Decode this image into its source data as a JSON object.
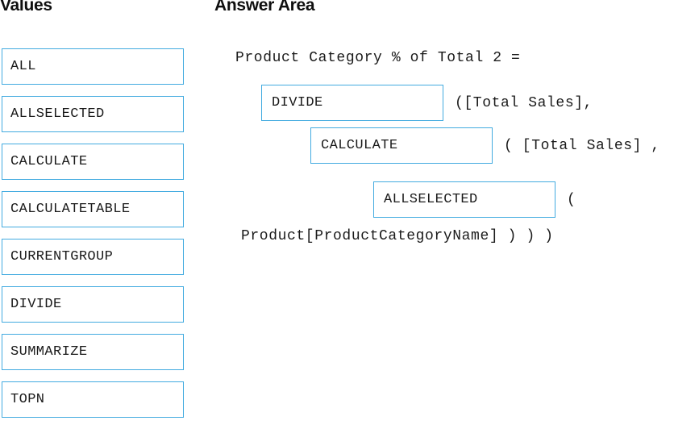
{
  "headings": {
    "values": "Values",
    "answer_area": "Answer Area"
  },
  "values_list": {
    "items": [
      {
        "label": "ALL"
      },
      {
        "label": "ALLSELECTED"
      },
      {
        "label": "CALCULATE"
      },
      {
        "label": "CALCULATETABLE"
      },
      {
        "label": "CURRENTGROUP"
      },
      {
        "label": "DIVIDE"
      },
      {
        "label": "SUMMARIZE"
      },
      {
        "label": "TOPN"
      }
    ]
  },
  "answer_area": {
    "line1": "Product Category % of Total 2 =",
    "slot1_value": "DIVIDE",
    "line2_after": "([Total Sales],",
    "slot2_value": "CALCULATE",
    "line3_after": "( [Total Sales] ,",
    "slot3_value": "ALLSELECTED",
    "line4_after": "(",
    "line5": "Product[ProductCategoryName] ) ) )"
  },
  "colors": {
    "box_border": "#43ABE0",
    "text": "#1a1a1a",
    "heading": "#0f0f0f",
    "background": "#ffffff"
  }
}
